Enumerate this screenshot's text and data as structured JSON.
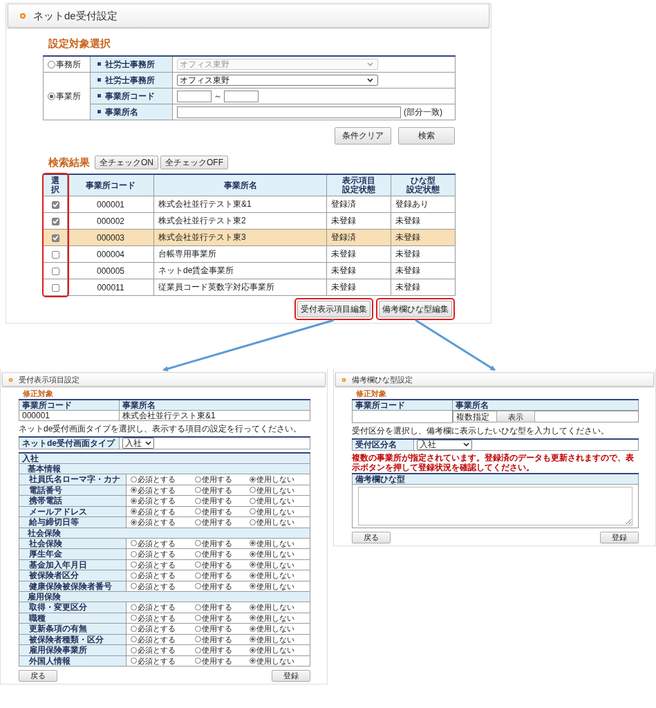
{
  "main": {
    "title": "ネットde受付設定",
    "filter": {
      "heading": "設定対象選択",
      "groups": [
        {
          "radio": "事務所",
          "selected": false,
          "fields": [
            {
              "label": "社労士事務所",
              "kind": "select",
              "value": "オフィス東野",
              "disabled": true
            }
          ]
        },
        {
          "radio": "事業所",
          "selected": true,
          "fields": [
            {
              "label": "社労士事務所",
              "kind": "select",
              "value": "オフィス東野",
              "disabled": false
            },
            {
              "label": "事業所コード",
              "kind": "range",
              "separator": "～"
            },
            {
              "label": "事業所名",
              "kind": "text",
              "note": "(部分一致)"
            }
          ]
        }
      ],
      "buttons": [
        "条件クリア",
        "検索"
      ]
    },
    "results": {
      "heading": "検索結果",
      "check_buttons": [
        "全チェックON",
        "全チェックOFF"
      ],
      "columns": [
        {
          "lines": [
            "選択"
          ],
          "callout": true
        },
        {
          "lines": [
            "事業所コード"
          ]
        },
        {
          "lines": [
            "事業所名"
          ]
        },
        {
          "lines": [
            "表示項目",
            "設定状態"
          ]
        },
        {
          "lines": [
            "ひな型",
            "設定状態"
          ]
        }
      ],
      "rows": [
        {
          "checked": true,
          "code": "000001",
          "name": "株式会社並行テスト東&1",
          "display_status": "登録済",
          "template_status": "登録あり",
          "selected": false
        },
        {
          "checked": true,
          "code": "000002",
          "name": "株式会社並行テスト東2",
          "display_status": "未登録",
          "template_status": "未登録",
          "selected": false
        },
        {
          "checked": true,
          "code": "000003",
          "name": "株式会社並行テスト東3",
          "display_status": "登録済",
          "template_status": "未登録",
          "selected": true
        },
        {
          "checked": false,
          "code": "000004",
          "name": "台帳専用事業所",
          "display_status": "未登録",
          "template_status": "未登録",
          "selected": false
        },
        {
          "checked": false,
          "code": "000005",
          "name": "ネットde賃金事業所",
          "display_status": "未登録",
          "template_status": "未登録",
          "selected": false
        },
        {
          "checked": false,
          "code": "000011",
          "name": "従業員コード英数字対応事業所",
          "display_status": "未登録",
          "template_status": "未登録",
          "selected": false
        }
      ],
      "actions": [
        {
          "label": "受付表示項目編集",
          "callout": true
        },
        {
          "label": "備考欄ひな型編集",
          "callout": true
        }
      ]
    }
  },
  "display_settings_dialog": {
    "title": "受付表示項目設定",
    "target_heading": "修正対象",
    "target_columns": [
      "事業所コード",
      "事業所名"
    ],
    "target_row": [
      "000001",
      "株式会社並行テスト東&1"
    ],
    "instruction": "ネットde受付画面タイプを選択し、表示する項目の設定を行ってください。",
    "type_field": {
      "label": "ネットde受付画面タイプ",
      "value": "入社"
    },
    "form_title": "入社",
    "sections": [
      {
        "title": "基本情報",
        "items": [
          {
            "label": "社員氏名ローマ字・カナ",
            "options": [
              {
                "label": "必須とする",
                "selected": false
              },
              {
                "label": "使用する",
                "selected": false
              },
              {
                "label": "使用しない",
                "selected": true
              }
            ]
          },
          {
            "label": "電話番号",
            "options": [
              {
                "label": "必須とする",
                "selected": true
              },
              {
                "label": "使用する",
                "selected": false
              },
              {
                "label": "使用しない",
                "selected": false
              }
            ]
          },
          {
            "label": "携帯電話",
            "options": [
              {
                "label": "必須とする",
                "selected": true
              },
              {
                "label": "使用する",
                "selected": false
              },
              {
                "label": "使用しない",
                "selected": false
              }
            ]
          },
          {
            "label": "メールアドレス",
            "options": [
              {
                "label": "必須とする",
                "selected": true
              },
              {
                "label": "使用する",
                "selected": false
              },
              {
                "label": "使用しない",
                "selected": false
              }
            ]
          },
          {
            "label": "給与締切日等",
            "options": [
              {
                "label": "必須とする",
                "selected": true
              },
              {
                "label": "使用する",
                "selected": false
              },
              {
                "label": "使用しない",
                "selected": false
              }
            ]
          }
        ]
      },
      {
        "title": "社会保険",
        "items": [
          {
            "label": "社会保険",
            "options": [
              {
                "label": "必須とする",
                "selected": false
              },
              {
                "label": "使用する",
                "selected": false
              },
              {
                "label": "使用しない",
                "selected": true
              }
            ]
          },
          {
            "label": "厚生年金",
            "options": [
              {
                "label": "必須とする",
                "selected": false
              },
              {
                "label": "使用する",
                "selected": false
              },
              {
                "label": "使用しない",
                "selected": true
              }
            ]
          },
          {
            "label": "基金加入年月日",
            "options": [
              {
                "label": "必須とする",
                "selected": false
              },
              {
                "label": "使用する",
                "selected": false
              },
              {
                "label": "使用しない",
                "selected": true
              }
            ]
          },
          {
            "label": "被保険者区分",
            "options": [
              {
                "label": "必須とする",
                "selected": false
              },
              {
                "label": "使用する",
                "selected": false
              },
              {
                "label": "使用しない",
                "selected": true
              }
            ]
          },
          {
            "label": "健康保険被保険者番号",
            "options": [
              {
                "label": "必須とする",
                "selected": false
              },
              {
                "label": "使用する",
                "selected": false
              },
              {
                "label": "使用しない",
                "selected": true
              }
            ]
          }
        ]
      },
      {
        "title": "雇用保険",
        "items": [
          {
            "label": "取得・変更区分",
            "options": [
              {
                "label": "必須とする",
                "selected": false
              },
              {
                "label": "使用する",
                "selected": false
              },
              {
                "label": "使用しない",
                "selected": true
              }
            ]
          },
          {
            "label": "職種",
            "options": [
              {
                "label": "必須とする",
                "selected": false
              },
              {
                "label": "使用する",
                "selected": false
              },
              {
                "label": "使用しない",
                "selected": true
              }
            ]
          },
          {
            "label": "更新条項の有無",
            "options": [
              {
                "label": "必須とする",
                "selected": false
              },
              {
                "label": "使用する",
                "selected": false
              },
              {
                "label": "使用しない",
                "selected": true
              }
            ]
          },
          {
            "label": "被保険者種類・区分",
            "options": [
              {
                "label": "必須とする",
                "selected": false
              },
              {
                "label": "使用する",
                "selected": false
              },
              {
                "label": "使用しない",
                "selected": true
              }
            ]
          },
          {
            "label": "雇用保険事業所",
            "options": [
              {
                "label": "必須とする",
                "selected": false
              },
              {
                "label": "使用する",
                "selected": false
              },
              {
                "label": "使用しない",
                "selected": true
              }
            ]
          },
          {
            "label": "外国人情報",
            "options": [
              {
                "label": "必須とする",
                "selected": false
              },
              {
                "label": "使用する",
                "selected": false
              },
              {
                "label": "使用しない",
                "selected": true
              }
            ]
          }
        ]
      }
    ],
    "buttons": [
      "戻る",
      "登録"
    ]
  },
  "template_dialog": {
    "title": "備考欄ひな型設定",
    "target_heading": "修正対象",
    "target_columns": [
      "事業所コード",
      "事業所名"
    ],
    "target_value": "複数指定",
    "show_button": "表示",
    "instruction": "受付区分を選択し、備考欄に表示したいひな型を入力してください。",
    "category_field": {
      "label": "受付区分名",
      "value": "入社"
    },
    "warning": "複数の事業所が指定されています。登録済のデータも更新されますので、表示ボタンを押して登録状況を確認してください。",
    "template_label": "備考欄ひな型",
    "buttons": [
      "戻る",
      "登録"
    ]
  }
}
